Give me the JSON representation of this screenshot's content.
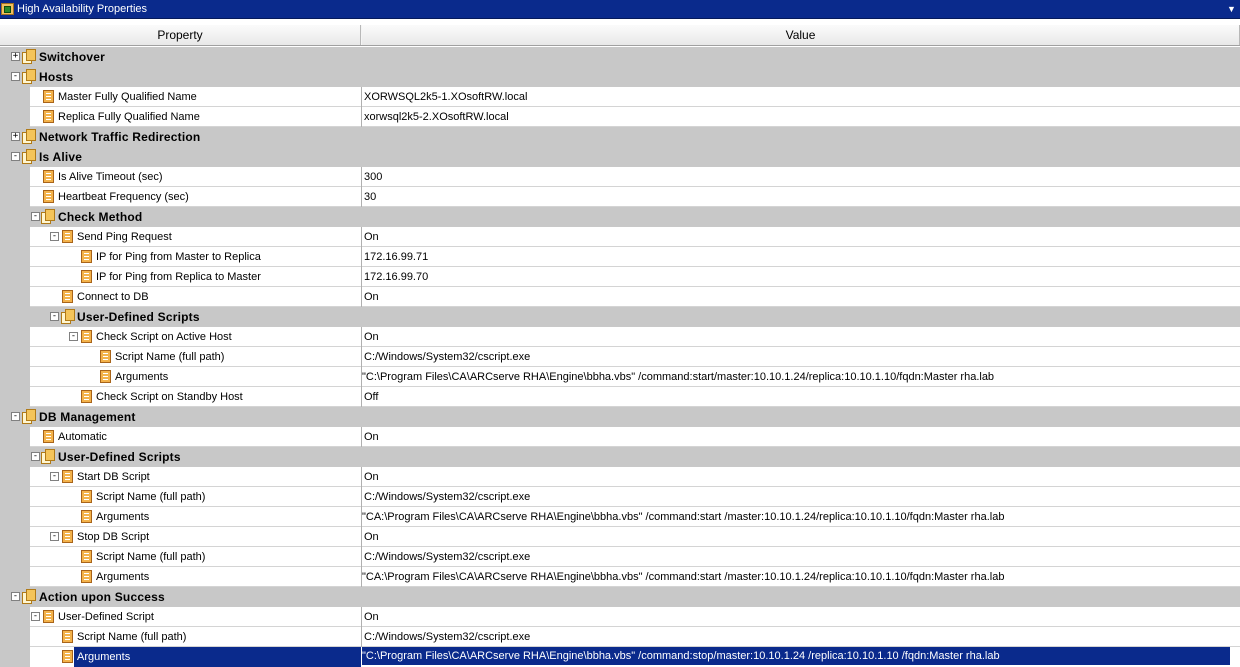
{
  "window": {
    "title": "High Availability Properties",
    "menu_icon": "dropdown-arrow-icon"
  },
  "columns": {
    "property": "Property",
    "value": "Value"
  },
  "rows": [
    {
      "label": "Switchover",
      "value": "",
      "type": "category",
      "expander": "+"
    },
    {
      "label": "Hosts",
      "value": "",
      "type": "category",
      "expander": "-"
    },
    {
      "label": "Master Fully Qualified Name",
      "value": "XORWSQL2k5-1.XOsoftRW.local",
      "type": "property"
    },
    {
      "label": "Replica Fully Qualified Name",
      "value": "xorwsql2k5-2.XOsoftRW.local",
      "type": "property"
    },
    {
      "label": "Network Traffic Redirection",
      "value": "",
      "type": "category",
      "expander": "+"
    },
    {
      "label": "Is Alive",
      "value": "",
      "type": "category",
      "expander": "-"
    },
    {
      "label": "Is Alive Timeout (sec)",
      "value": "300",
      "type": "property"
    },
    {
      "label": "Heartbeat Frequency (sec)",
      "value": "30",
      "type": "property"
    },
    {
      "label": "Check Method",
      "value": "",
      "type": "category",
      "expander": "-"
    },
    {
      "label": "Send Ping Request",
      "value": "On",
      "type": "property",
      "expander": "-"
    },
    {
      "label": "IP for Ping from Master to Replica",
      "value": "172.16.99.71",
      "type": "property"
    },
    {
      "label": "IP for Ping from Replica to Master",
      "value": "172.16.99.70",
      "type": "property"
    },
    {
      "label": "Connect to DB",
      "value": "On",
      "type": "property"
    },
    {
      "label": "User-Defined Scripts",
      "value": "",
      "type": "category",
      "expander": "-"
    },
    {
      "label": "Check Script on Active Host",
      "value": "On",
      "type": "property",
      "expander": "-"
    },
    {
      "label": "Script Name (full path)",
      "value": "C:/Windows/System32/cscript.exe",
      "type": "property"
    },
    {
      "label": "Arguments",
      "value": "\"C:\\Program Files\\CA\\ARCserve RHA\\Engine\\bbha.vbs\" /command:start/master:10.10.1.24/replica:10.10.1.10/fqdn:Master rha.lab",
      "type": "property"
    },
    {
      "label": "Check Script on Standby Host",
      "value": "Off",
      "type": "property"
    },
    {
      "label": "DB Management",
      "value": "",
      "type": "category",
      "expander": "-"
    },
    {
      "label": "Automatic",
      "value": "On",
      "type": "property"
    },
    {
      "label": "User-Defined Scripts",
      "value": "",
      "type": "category",
      "expander": "-"
    },
    {
      "label": "Start DB Script",
      "value": "On",
      "type": "property",
      "expander": "-"
    },
    {
      "label": "Script Name (full path)",
      "value": "C:/Windows/System32/cscript.exe",
      "type": "property"
    },
    {
      "label": "Arguments",
      "value": "\"CA:\\Program Files\\CA\\ARCserve RHA\\Engine\\bbha.vbs\" /command:start /master:10.10.1.24/replica:10.10.1.10/fqdn:Master rha.lab",
      "type": "property"
    },
    {
      "label": "Stop DB Script",
      "value": "On",
      "type": "property",
      "expander": "-"
    },
    {
      "label": "Script Name (full path)",
      "value": "C:/Windows/System32/cscript.exe",
      "type": "property"
    },
    {
      "label": "Arguments",
      "value": "\"CA:\\Program Files\\CA\\ARCserve RHA\\Engine\\bbha.vbs\" /command:start /master:10.10.1.24/replica:10.10.1.10/fqdn:Master rha.lab",
      "type": "property"
    },
    {
      "label": "Action upon Success",
      "value": "",
      "type": "category",
      "expander": "-"
    },
    {
      "label": "User-Defined Script",
      "value": "On",
      "type": "property",
      "expander": "-"
    },
    {
      "label": "Script Name (full path)",
      "value": "C:/Windows/System32/cscript.exe",
      "type": "property"
    },
    {
      "label": "Arguments",
      "value": "\"C:\\Program Files\\CA\\ARCserve RHA\\Engine\\bbha.vbs\" /command:stop/master:10.10.1.24 /replica:10.10.1.10 /fqdn:Master rha.lab",
      "type": "property",
      "selected": true
    }
  ]
}
